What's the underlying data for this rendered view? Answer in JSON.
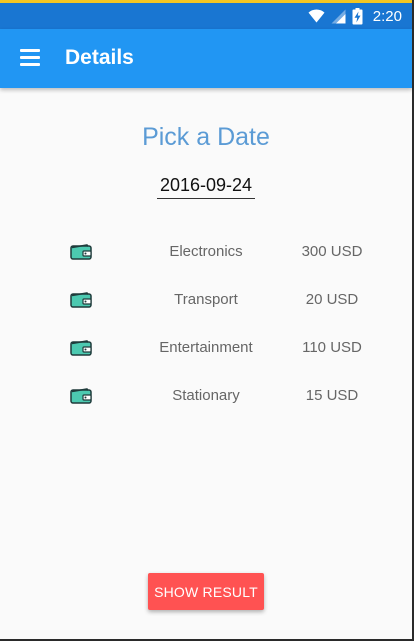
{
  "status_bar": {
    "time": "2:20",
    "icons": [
      "wifi-icon",
      "signal-icon",
      "battery-charging-icon"
    ]
  },
  "app_bar": {
    "title": "Details",
    "menu_icon": "hamburger-menu-icon"
  },
  "main": {
    "heading": "Pick a Date",
    "date_value": "2016-09-24",
    "expenses": [
      {
        "icon": "wallet-icon",
        "category": "Electronics",
        "amount": "300 USD"
      },
      {
        "icon": "wallet-icon",
        "category": "Transport",
        "amount": "20 USD"
      },
      {
        "icon": "wallet-icon",
        "category": "Entertainment",
        "amount": "110 USD"
      },
      {
        "icon": "wallet-icon",
        "category": "Stationary",
        "amount": "15 USD"
      }
    ],
    "button_label": "SHOW RESULT"
  },
  "colors": {
    "status_bar": "#1976d2",
    "app_bar": "#2196f3",
    "heading": "#5b9bd5",
    "button": "#ff5252",
    "wallet": "#4cc9b0"
  }
}
